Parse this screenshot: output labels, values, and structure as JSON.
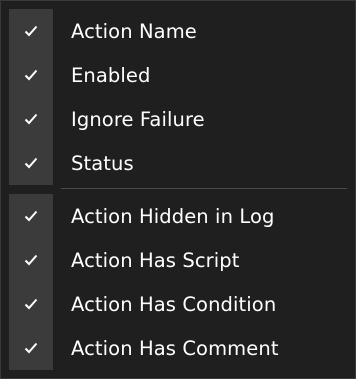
{
  "menu": {
    "groups": [
      {
        "items": [
          {
            "label": "Action Name",
            "checked": true
          },
          {
            "label": "Enabled",
            "checked": true
          },
          {
            "label": "Ignore Failure",
            "checked": true
          },
          {
            "label": "Status",
            "checked": true
          }
        ]
      },
      {
        "items": [
          {
            "label": "Action Hidden in Log",
            "checked": true
          },
          {
            "label": "Action Has Script",
            "checked": true
          },
          {
            "label": "Action Has Condition",
            "checked": true
          },
          {
            "label": "Action Has Comment",
            "checked": true
          }
        ]
      }
    ],
    "colors": {
      "background": "#1f1f1f",
      "check_column": "#3b3b3b",
      "text": "#ffffff",
      "checkmark": "#ffffff"
    },
    "icons": {
      "check": "checkmark-icon"
    }
  }
}
